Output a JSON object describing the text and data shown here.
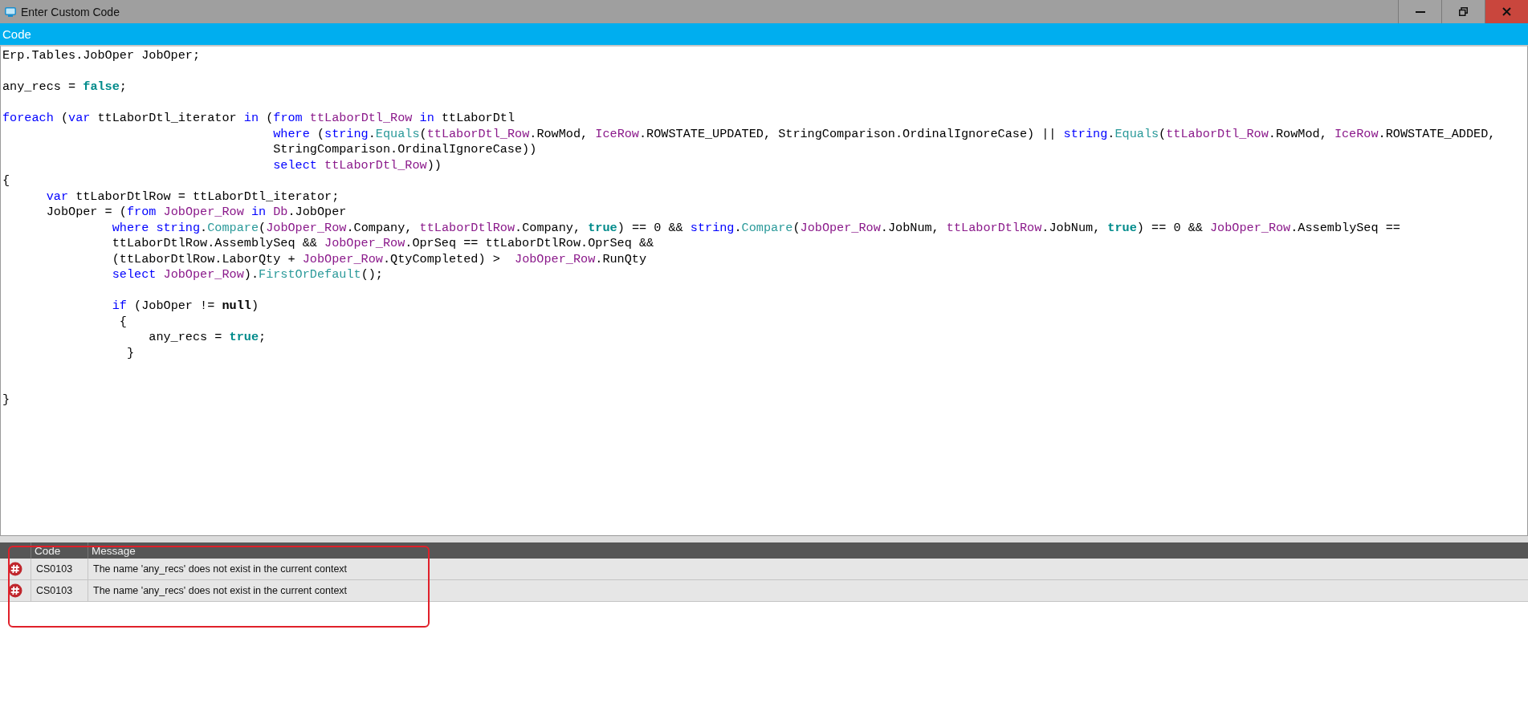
{
  "window": {
    "title": "Enter Custom Code"
  },
  "panel": {
    "title": "Code"
  },
  "code_lines": [
    {
      "kind": "code",
      "tokens": [
        {
          "kind": "text",
          "text": "Erp.Tables.JobOper JobOper;"
        }
      ]
    },
    {
      "kind": "blank"
    },
    {
      "kind": "code",
      "tokens": [
        {
          "kind": "text",
          "text": "any_recs = "
        },
        {
          "kind": "literal",
          "text": "false"
        },
        {
          "kind": "text",
          "text": ";"
        }
      ]
    },
    {
      "kind": "blank"
    },
    {
      "kind": "code",
      "tokens": [
        {
          "kind": "keyword",
          "text": "foreach"
        },
        {
          "kind": "text",
          "text": " ("
        },
        {
          "kind": "keyword",
          "text": "var"
        },
        {
          "kind": "text",
          "text": " ttLaborDtl_iterator "
        },
        {
          "kind": "keyword",
          "text": "in"
        },
        {
          "kind": "text",
          "text": " ("
        },
        {
          "kind": "keyword",
          "text": "from"
        },
        {
          "kind": "type",
          "text": " ttLaborDtl_Row"
        },
        {
          "kind": "keyword",
          "text": " in"
        },
        {
          "kind": "text",
          "text": " ttLaborDtl"
        }
      ]
    },
    {
      "kind": "code",
      "tokens": [
        {
          "kind": "keyword",
          "text": "                                     where"
        },
        {
          "kind": "text",
          "text": " ("
        },
        {
          "kind": "keyword",
          "text": "string"
        },
        {
          "kind": "text",
          "text": "."
        },
        {
          "kind": "method",
          "text": "Equals"
        },
        {
          "kind": "text",
          "text": "("
        },
        {
          "kind": "type",
          "text": "ttLaborDtl_Row"
        },
        {
          "kind": "text",
          "text": ".RowMod, "
        },
        {
          "kind": "type",
          "text": "IceRow"
        },
        {
          "kind": "text",
          "text": ".ROWSTATE_UPDATED, StringComparison.OrdinalIgnoreCase) || "
        },
        {
          "kind": "keyword",
          "text": "string"
        },
        {
          "kind": "text",
          "text": "."
        },
        {
          "kind": "method",
          "text": "Equals"
        },
        {
          "kind": "text",
          "text": "("
        },
        {
          "kind": "type",
          "text": "ttLaborDtl_Row"
        },
        {
          "kind": "text",
          "text": ".RowMod, "
        },
        {
          "kind": "type",
          "text": "IceRow"
        },
        {
          "kind": "text",
          "text": ".ROWSTATE_ADDED,"
        }
      ]
    },
    {
      "kind": "code",
      "tokens": [
        {
          "kind": "text",
          "text": "                                     StringComparison.OrdinalIgnoreCase))"
        }
      ]
    },
    {
      "kind": "code",
      "tokens": [
        {
          "kind": "keyword",
          "text": "                                     select"
        },
        {
          "kind": "type",
          "text": " ttLaborDtl_Row"
        },
        {
          "kind": "text",
          "text": "))"
        }
      ]
    },
    {
      "kind": "code",
      "tokens": [
        {
          "kind": "text",
          "text": "{"
        }
      ]
    },
    {
      "kind": "code",
      "tokens": [
        {
          "kind": "keyword",
          "text": "      var"
        },
        {
          "kind": "text",
          "text": " ttLaborDtlRow = ttLaborDtl_iterator;"
        }
      ]
    },
    {
      "kind": "code",
      "tokens": [
        {
          "kind": "text",
          "text": "      JobOper = ("
        },
        {
          "kind": "keyword",
          "text": "from"
        },
        {
          "kind": "type",
          "text": " JobOper_Row"
        },
        {
          "kind": "keyword",
          "text": " in"
        },
        {
          "kind": "type",
          "text": " Db"
        },
        {
          "kind": "text",
          "text": ".JobOper"
        }
      ]
    },
    {
      "kind": "code",
      "tokens": [
        {
          "kind": "keyword",
          "text": "               where"
        },
        {
          "kind": "keyword",
          "text": " string"
        },
        {
          "kind": "text",
          "text": "."
        },
        {
          "kind": "method",
          "text": "Compare"
        },
        {
          "kind": "text",
          "text": "("
        },
        {
          "kind": "type",
          "text": "JobOper_Row"
        },
        {
          "kind": "text",
          "text": ".Company, "
        },
        {
          "kind": "type",
          "text": "ttLaborDtlRow"
        },
        {
          "kind": "text",
          "text": ".Company, "
        },
        {
          "kind": "literal",
          "text": "true"
        },
        {
          "kind": "text",
          "text": ") == 0 && "
        },
        {
          "kind": "keyword",
          "text": "string"
        },
        {
          "kind": "text",
          "text": "."
        },
        {
          "kind": "method",
          "text": "Compare"
        },
        {
          "kind": "text",
          "text": "("
        },
        {
          "kind": "type",
          "text": "JobOper_Row"
        },
        {
          "kind": "text",
          "text": ".JobNum, "
        },
        {
          "kind": "type",
          "text": "ttLaborDtlRow"
        },
        {
          "kind": "text",
          "text": ".JobNum, "
        },
        {
          "kind": "literal",
          "text": "true"
        },
        {
          "kind": "text",
          "text": ") == 0 && "
        },
        {
          "kind": "type",
          "text": "JobOper_Row"
        },
        {
          "kind": "text",
          "text": ".AssemblySeq =="
        }
      ]
    },
    {
      "kind": "code",
      "tokens": [
        {
          "kind": "text",
          "text": "               ttLaborDtlRow.AssemblySeq && "
        },
        {
          "kind": "type",
          "text": "JobOper_Row"
        },
        {
          "kind": "text",
          "text": ".OprSeq == ttLaborDtlRow.OprSeq &&"
        }
      ]
    },
    {
      "kind": "code",
      "tokens": [
        {
          "kind": "text",
          "text": "               (ttLaborDtlRow.LaborQty + "
        },
        {
          "kind": "type",
          "text": "JobOper_Row"
        },
        {
          "kind": "text",
          "text": ".QtyCompleted) >  "
        },
        {
          "kind": "type",
          "text": "JobOper_Row"
        },
        {
          "kind": "text",
          "text": ".RunQty"
        }
      ]
    },
    {
      "kind": "code",
      "tokens": [
        {
          "kind": "keyword",
          "text": "               select"
        },
        {
          "kind": "type",
          "text": " JobOper_Row"
        },
        {
          "kind": "text",
          "text": ")."
        },
        {
          "kind": "method",
          "text": "FirstOrDefault"
        },
        {
          "kind": "text",
          "text": "();"
        }
      ]
    },
    {
      "kind": "blank"
    },
    {
      "kind": "code",
      "tokens": [
        {
          "kind": "keyword",
          "text": "               if"
        },
        {
          "kind": "text",
          "text": " (JobOper != "
        },
        {
          "kind": "bold",
          "text": "null"
        },
        {
          "kind": "text",
          "text": ")"
        }
      ]
    },
    {
      "kind": "code",
      "tokens": [
        {
          "kind": "text",
          "text": "                {"
        }
      ]
    },
    {
      "kind": "code",
      "tokens": [
        {
          "kind": "text",
          "text": "                    any_recs = "
        },
        {
          "kind": "literal",
          "text": "true"
        },
        {
          "kind": "text",
          "text": ";"
        }
      ]
    },
    {
      "kind": "code",
      "tokens": [
        {
          "kind": "text",
          "text": "                 }"
        }
      ]
    },
    {
      "kind": "blank"
    },
    {
      "kind": "blank"
    },
    {
      "kind": "code",
      "tokens": [
        {
          "kind": "text",
          "text": "}"
        }
      ]
    }
  ],
  "errors": {
    "columns": [
      "Code",
      "Message"
    ],
    "rows": [
      {
        "kind": "error",
        "code": "CS0103",
        "message": "The name 'any_recs' does not exist in the current context"
      },
      {
        "kind": "error",
        "code": "CS0103",
        "message": "The name 'any_recs' does not exist in the current context"
      }
    ]
  }
}
